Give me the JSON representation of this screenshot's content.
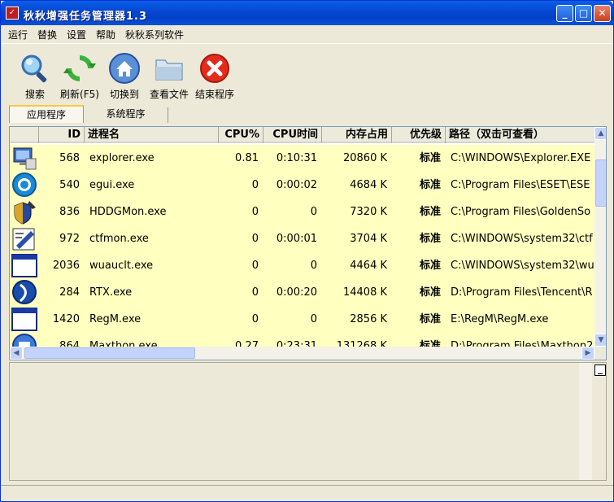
{
  "window": {
    "title": "秋秋增强任务管理器1.3"
  },
  "titlebar": {
    "min": "_",
    "max": "□",
    "close": "✕"
  },
  "menu": {
    "items": [
      "运行",
      "替换",
      "设置",
      "帮助",
      "秋秋系列软件"
    ]
  },
  "toolbar": {
    "items": [
      {
        "label": "搜索",
        "icon": "search-icon"
      },
      {
        "label": "刷新(F5)",
        "icon": "refresh-icon"
      },
      {
        "label": "切换到",
        "icon": "home-icon"
      },
      {
        "label": "查看文件",
        "icon": "folder-icon"
      },
      {
        "label": "结束程序",
        "icon": "close-icon"
      }
    ]
  },
  "tabs": [
    "应用程序",
    "系统程序"
  ],
  "columns": [
    "ID",
    "进程名",
    "CPU%",
    "CPU时间",
    "内存占用",
    "优先级",
    "路径（双击可查看）"
  ],
  "rows": [
    {
      "id": "568",
      "name": "explorer.exe",
      "cpu": "0.81",
      "cputime": "0:10:31",
      "mem": "20860 K",
      "priority": "标准",
      "path": "C:\\WINDOWS\\Explorer.EXE"
    },
    {
      "id": "540",
      "name": "egui.exe",
      "cpu": "0",
      "cputime": "0:00:02",
      "mem": "4684 K",
      "priority": "标准",
      "path": "C:\\Program Files\\ESET\\ESE"
    },
    {
      "id": "836",
      "name": "HDDGMon.exe",
      "cpu": "0",
      "cputime": "0",
      "mem": "7320 K",
      "priority": "标准",
      "path": "C:\\Program Files\\GoldenSo"
    },
    {
      "id": "972",
      "name": "ctfmon.exe",
      "cpu": "0",
      "cputime": "0:00:01",
      "mem": "3704 K",
      "priority": "标准",
      "path": "C:\\WINDOWS\\system32\\ctf"
    },
    {
      "id": "2036",
      "name": "wuauclt.exe",
      "cpu": "0",
      "cputime": "0",
      "mem": "4464 K",
      "priority": "标准",
      "path": "C:\\WINDOWS\\system32\\wu"
    },
    {
      "id": "284",
      "name": "RTX.exe",
      "cpu": "0",
      "cputime": "0:00:20",
      "mem": "14408 K",
      "priority": "标准",
      "path": "D:\\Program Files\\Tencent\\R"
    },
    {
      "id": "1420",
      "name": "RegM.exe",
      "cpu": "0",
      "cputime": "0",
      "mem": "2856 K",
      "priority": "标准",
      "path": "E:\\RegM\\RegM.exe"
    },
    {
      "id": "864",
      "name": "Maxthon.exe",
      "cpu": "0.27",
      "cputime": "0:23:31",
      "mem": "131268 K",
      "priority": "标准",
      "path": "D:\\Program Files\\Maxthon2"
    }
  ],
  "row_icons": [
    "computer-icon",
    "eset-icon",
    "shield-icon",
    "edit-icon",
    "window-icon",
    "rtx-icon",
    "window-icon",
    "maxthon-icon"
  ],
  "scroll": {
    "up": "▲",
    "down": "▼",
    "left": "◀",
    "right": "▶"
  },
  "detail": {
    "button": "_"
  }
}
